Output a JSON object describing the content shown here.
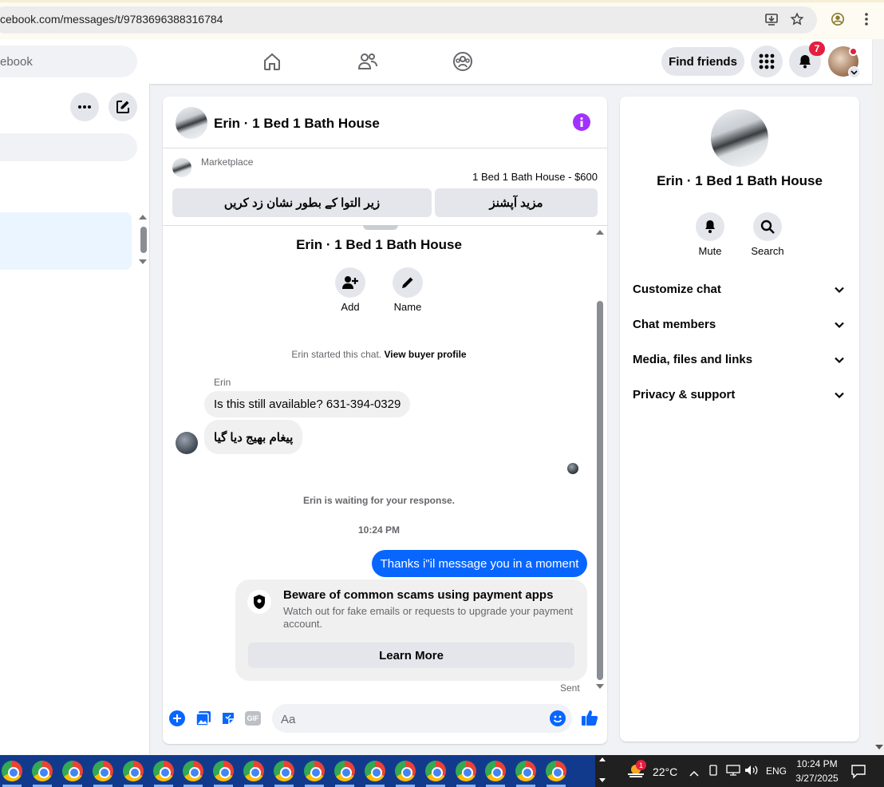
{
  "browser": {
    "url": "cebook.com/messages/t/9783696388316784"
  },
  "topbar": {
    "search_placeholder": "ebook",
    "find_friends": "Find friends",
    "notifications_count": "7"
  },
  "chat": {
    "title": "Erin · 1 Bed 1 Bath House",
    "marketplace_label": "Marketplace",
    "listing": "1 Bed 1 Bath House - $600",
    "mark_sold_button": "زیر التوا کے بطور نشان زد کریں",
    "more_options_button": "مزید آپشنز",
    "header_name": "Erin · 1 Bed 1 Bath House",
    "add_label": "Add",
    "name_label": "Name",
    "started_text": "Erin started this chat.",
    "view_profile": "View buyer profile",
    "sender_name": "Erin",
    "messages": [
      "Is this still available? 631-394-0329",
      "پیغام بھیج دیا گیا"
    ],
    "waiting_text": "Erin is waiting for your response.",
    "time": "10:24 PM",
    "sent_message": "Thanks i\"il message you in a moment",
    "scam_title": "Beware of common scams using payment apps",
    "scam_body": "Watch out for fake emails or requests to upgrade your payment account.",
    "learn_more": "Learn More",
    "sent_status": "Sent",
    "composer_placeholder": "Aa"
  },
  "info": {
    "name": "Erin · 1 Bed 1 Bath House",
    "mute": "Mute",
    "search": "Search",
    "sections": [
      "Customize chat",
      "Chat members",
      "Media, files and links",
      "Privacy & support"
    ]
  },
  "taskbar": {
    "weather": "22°C",
    "weather_badge": "1",
    "lang": "ENG",
    "time": "10:24 PM",
    "date": "3/27/2025"
  },
  "colors": {
    "accent": "#0866ff",
    "purple": "#a033ff",
    "badge": "#e41e3f"
  }
}
